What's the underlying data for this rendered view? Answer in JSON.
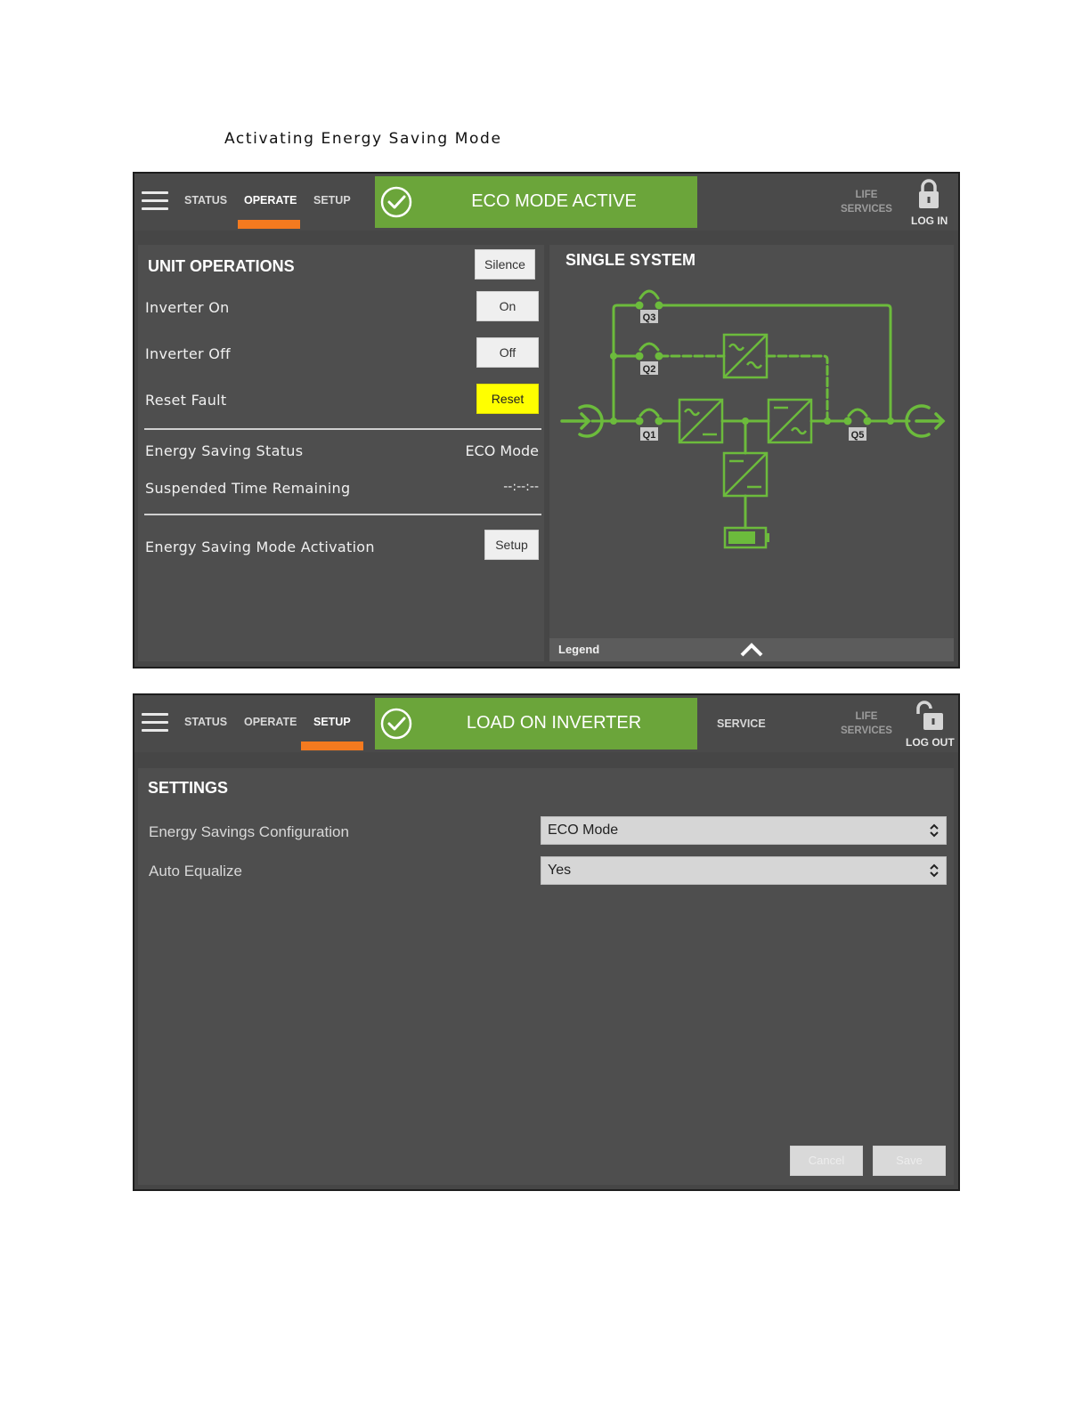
{
  "document": {
    "title": "Activating Energy Saving Mode"
  },
  "screen1": {
    "nav": {
      "status": "STATUS",
      "operate": "OPERATE",
      "setup": "SETUP"
    },
    "banner": "ECO MODE ACTIVE",
    "life_services": [
      "LIFE",
      "SERVICES"
    ],
    "login_label": "LOG IN",
    "unit_operations": {
      "title": "UNIT OPERATIONS",
      "silence": "Silence",
      "rows": [
        {
          "label": "Inverter On",
          "button": "On"
        },
        {
          "label": "Inverter Off",
          "button": "Off"
        },
        {
          "label": "Reset Fault",
          "button": "Reset"
        }
      ],
      "energy_saving_status_label": "Energy Saving Status",
      "energy_saving_status_value": "ECO Mode",
      "suspended_label": "Suspended Time Remaining",
      "suspended_value": "--:--:--",
      "activation_label": "Energy Saving Mode Activation",
      "activation_button": "Setup"
    },
    "single_system": {
      "title": "SINGLE SYSTEM",
      "switches": [
        "Q3",
        "Q2",
        "Q1",
        "Q5"
      ],
      "legend": "Legend"
    },
    "colors": {
      "accent_green": "#6ba53a",
      "diagram_green": "#6cbb3c",
      "tab_orange": "#f47a1f",
      "reset_yellow": "#ffff00"
    }
  },
  "screen2": {
    "nav": {
      "status": "STATUS",
      "operate": "OPERATE",
      "setup": "SETUP",
      "service": "SERVICE"
    },
    "banner": "LOAD ON INVERTER",
    "life_services": [
      "LIFE",
      "SERVICES"
    ],
    "logout_label": "LOG OUT",
    "settings": {
      "title": "SETTINGS",
      "energy_config_label": "Energy Savings Configuration",
      "energy_config_value": "ECO Mode",
      "auto_equalize_label": "Auto Equalize",
      "auto_equalize_value": "Yes",
      "cancel": "Cancel",
      "save": "Save"
    }
  }
}
